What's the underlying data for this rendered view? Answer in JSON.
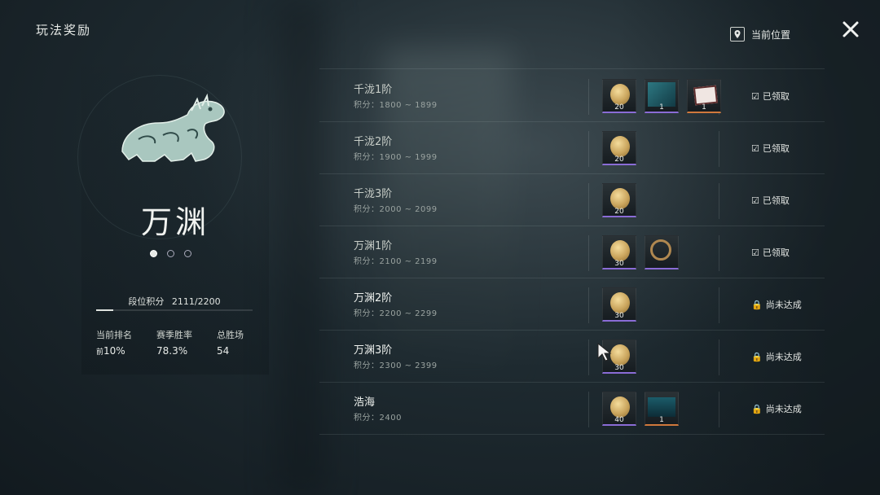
{
  "header": {
    "title": "玩法奖励",
    "location_label": "当前位置"
  },
  "rank": {
    "name": "万渊",
    "score_label": "段位积分",
    "score_value": "2111/2200",
    "score_progress": 0.11,
    "page_dots": 3,
    "active_dot": 0,
    "stats": [
      {
        "label": "当前排名",
        "prefix": "前",
        "value": "10%"
      },
      {
        "label": "赛季胜率",
        "prefix": "",
        "value": "78.3%"
      },
      {
        "label": "总胜场",
        "prefix": "",
        "value": "54"
      }
    ]
  },
  "tiers": [
    {
      "name": "千泷1阶",
      "range": "积分：1800 ~ 1899",
      "status": "已领取",
      "status_icon": "check-box-icon",
      "rewards": [
        {
          "type": "coin",
          "count": "20",
          "rarity": "purple"
        },
        {
          "type": "scene",
          "count": "1",
          "rarity": "purple"
        },
        {
          "type": "card",
          "count": "1",
          "rarity": "orange"
        }
      ]
    },
    {
      "name": "千泷2阶",
      "range": "积分：1900 ~ 1999",
      "status": "已领取",
      "status_icon": "check-box-icon",
      "rewards": [
        {
          "type": "coin",
          "count": "20",
          "rarity": "purple"
        }
      ]
    },
    {
      "name": "千泷3阶",
      "range": "积分：2000 ~ 2099",
      "status": "已领取",
      "status_icon": "check-box-icon",
      "rewards": [
        {
          "type": "coin",
          "count": "20",
          "rarity": "purple"
        }
      ]
    },
    {
      "name": "万渊1阶",
      "range": "积分：2100 ~ 2199",
      "status": "已领取",
      "status_icon": "check-box-icon",
      "rewards": [
        {
          "type": "coin",
          "count": "30",
          "rarity": "purple"
        },
        {
          "type": "ring",
          "count": "",
          "rarity": "purple"
        }
      ]
    },
    {
      "name": "万渊2阶",
      "range": "积分：2200 ~ 2299",
      "status": "尚未达成",
      "status_icon": "lock-icon",
      "rewards": [
        {
          "type": "coin",
          "count": "30",
          "rarity": "purple"
        }
      ]
    },
    {
      "name": "万渊3阶",
      "range": "积分：2300 ~ 2399",
      "status": "尚未达成",
      "status_icon": "lock-icon",
      "rewards": [
        {
          "type": "coin",
          "count": "30",
          "rarity": "purple"
        }
      ]
    },
    {
      "name": "浩海",
      "range": "积分：2400",
      "status": "尚未达成",
      "status_icon": "lock-icon",
      "rewards": [
        {
          "type": "coin",
          "count": "40",
          "rarity": "purple"
        },
        {
          "type": "wave",
          "count": "1",
          "rarity": "orange"
        }
      ]
    }
  ]
}
